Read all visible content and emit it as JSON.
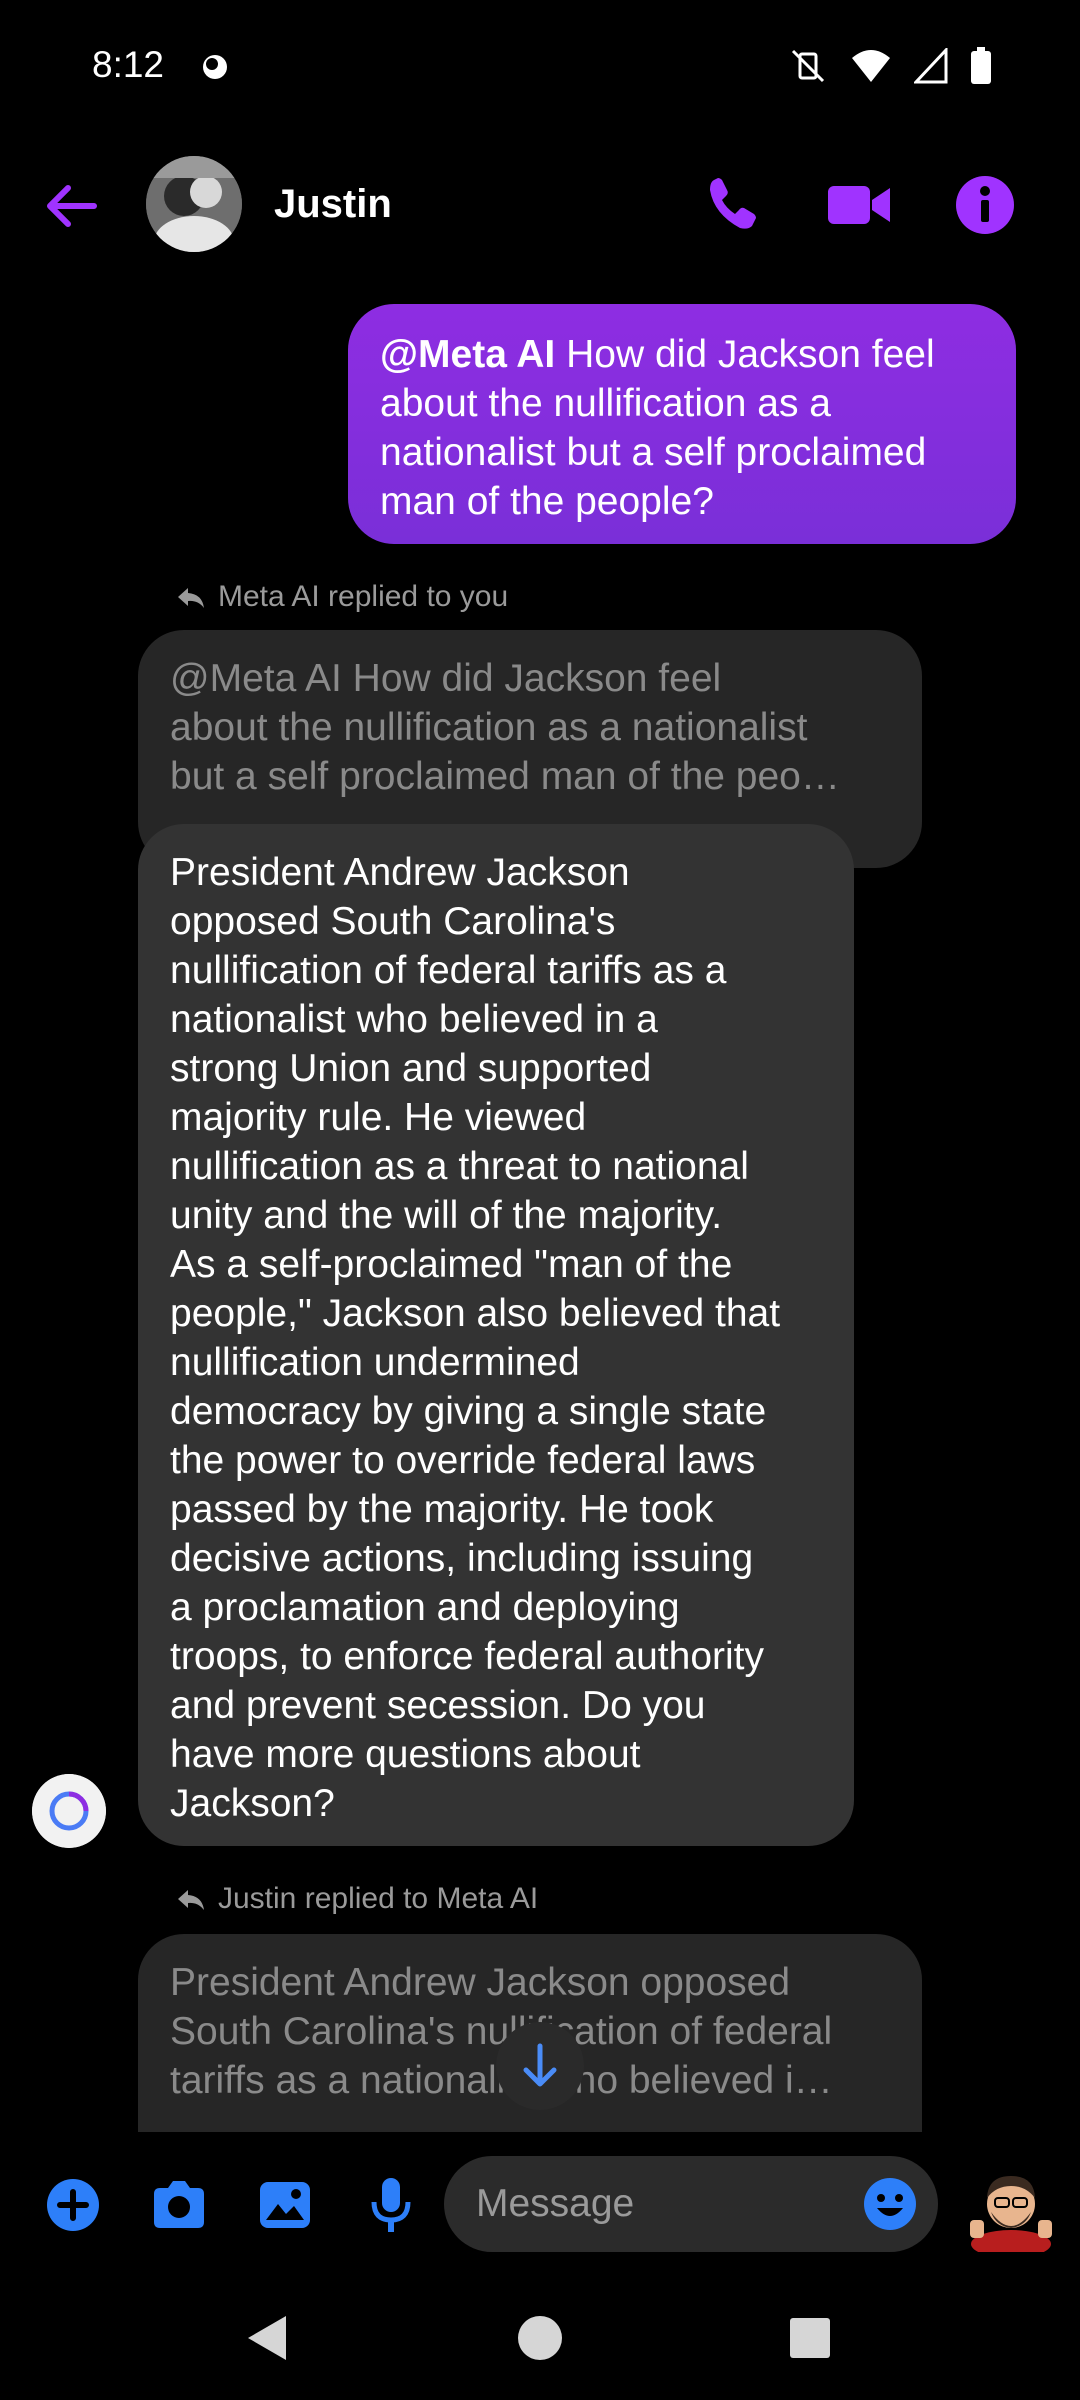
{
  "status_bar": {
    "time": "8:12"
  },
  "header": {
    "contact_name": "Justin"
  },
  "messages": {
    "outgoing": {
      "mention": "@Meta AI",
      "lines": [
        " How did Jackson feel",
        "about the nullification as a",
        "nationalist but a self proclaimed",
        "man of the people?"
      ]
    },
    "reply_label_1": "Meta AI replied to you",
    "quoted_1": [
      "@Meta AI  How did Jackson feel",
      "about the nullification as a nationalist",
      "but a self proclaimed man of the peo…"
    ],
    "incoming_lines": [
      "President Andrew Jackson",
      "opposed South Carolina's",
      "nullification of federal tariffs as a",
      "nationalist who believed in a",
      "strong Union and supported",
      "majority rule. He viewed",
      "nullification as a threat to national",
      "unity and the will of the majority.",
      "As a self-proclaimed \"man of the",
      "people,\" Jackson also believed that",
      "nullification undermined",
      "democracy by giving a single state",
      "the power to override federal laws",
      "passed by the majority. He took",
      "decisive actions, including issuing",
      "a proclamation and deploying",
      "troops, to enforce federal authority",
      "and prevent secession. Do you",
      "have more questions about",
      "Jackson?"
    ],
    "reply_label_2": "Justin replied to Meta AI",
    "quoted_2": [
      "President Andrew Jackson opposed",
      "South Carolina's nullification of federal",
      "tariffs as a nationalist who believed i…"
    ]
  },
  "composer": {
    "placeholder": "Message"
  },
  "colors": {
    "accent_purple": "#8e2de2",
    "icon_blue": "#2d7ff9",
    "header_purple": "#a033ff"
  }
}
